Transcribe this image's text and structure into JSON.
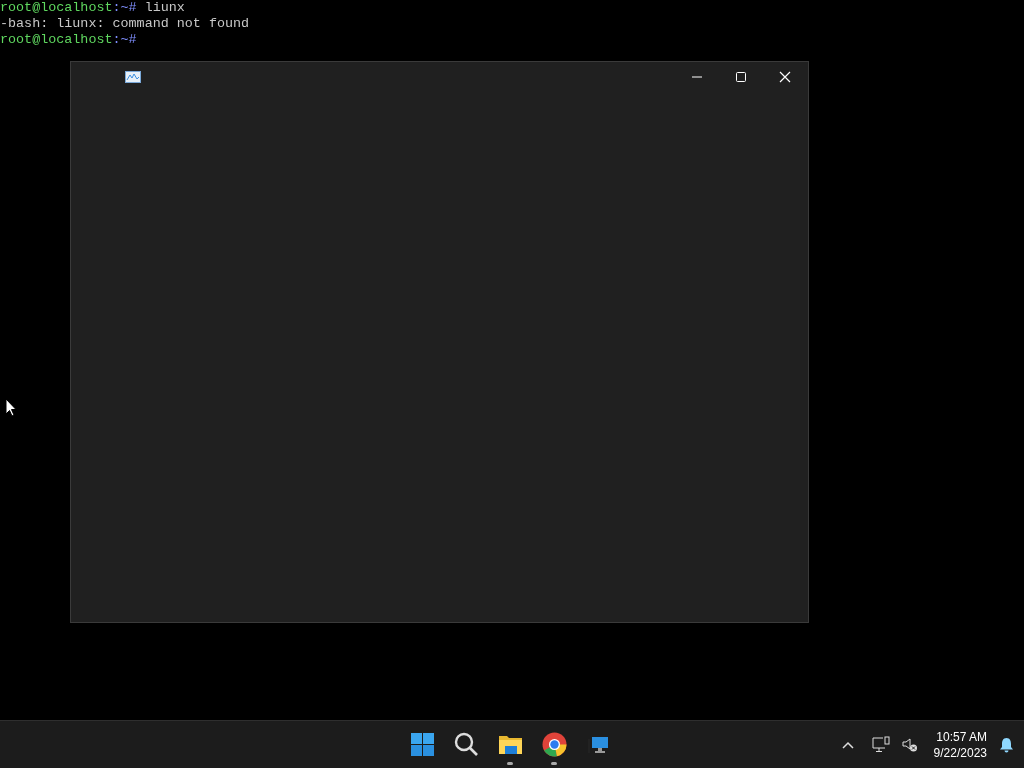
{
  "terminal": {
    "lines": [
      {
        "kind": "prompt",
        "host": "root@localhost",
        "path": ":~#",
        "command": "liunx"
      },
      {
        "kind": "output",
        "text": "-bash: liunx: command not found"
      },
      {
        "kind": "prompt",
        "host": "root@localhost",
        "path": ":~#"
      }
    ]
  },
  "window": {
    "controls": [
      {
        "kind": "minimize"
      },
      {
        "kind": "maximize"
      },
      {
        "kind": "close"
      }
    ]
  },
  "taskbar": {
    "apps": [
      {
        "kind": "start",
        "running": false
      },
      {
        "kind": "search",
        "running": false
      },
      {
        "kind": "files",
        "running": true
      },
      {
        "kind": "browser",
        "running": true
      },
      {
        "kind": "remote",
        "running": false
      }
    ],
    "tray": {
      "time": "10:57 AM",
      "date": "9/22/2023"
    }
  }
}
